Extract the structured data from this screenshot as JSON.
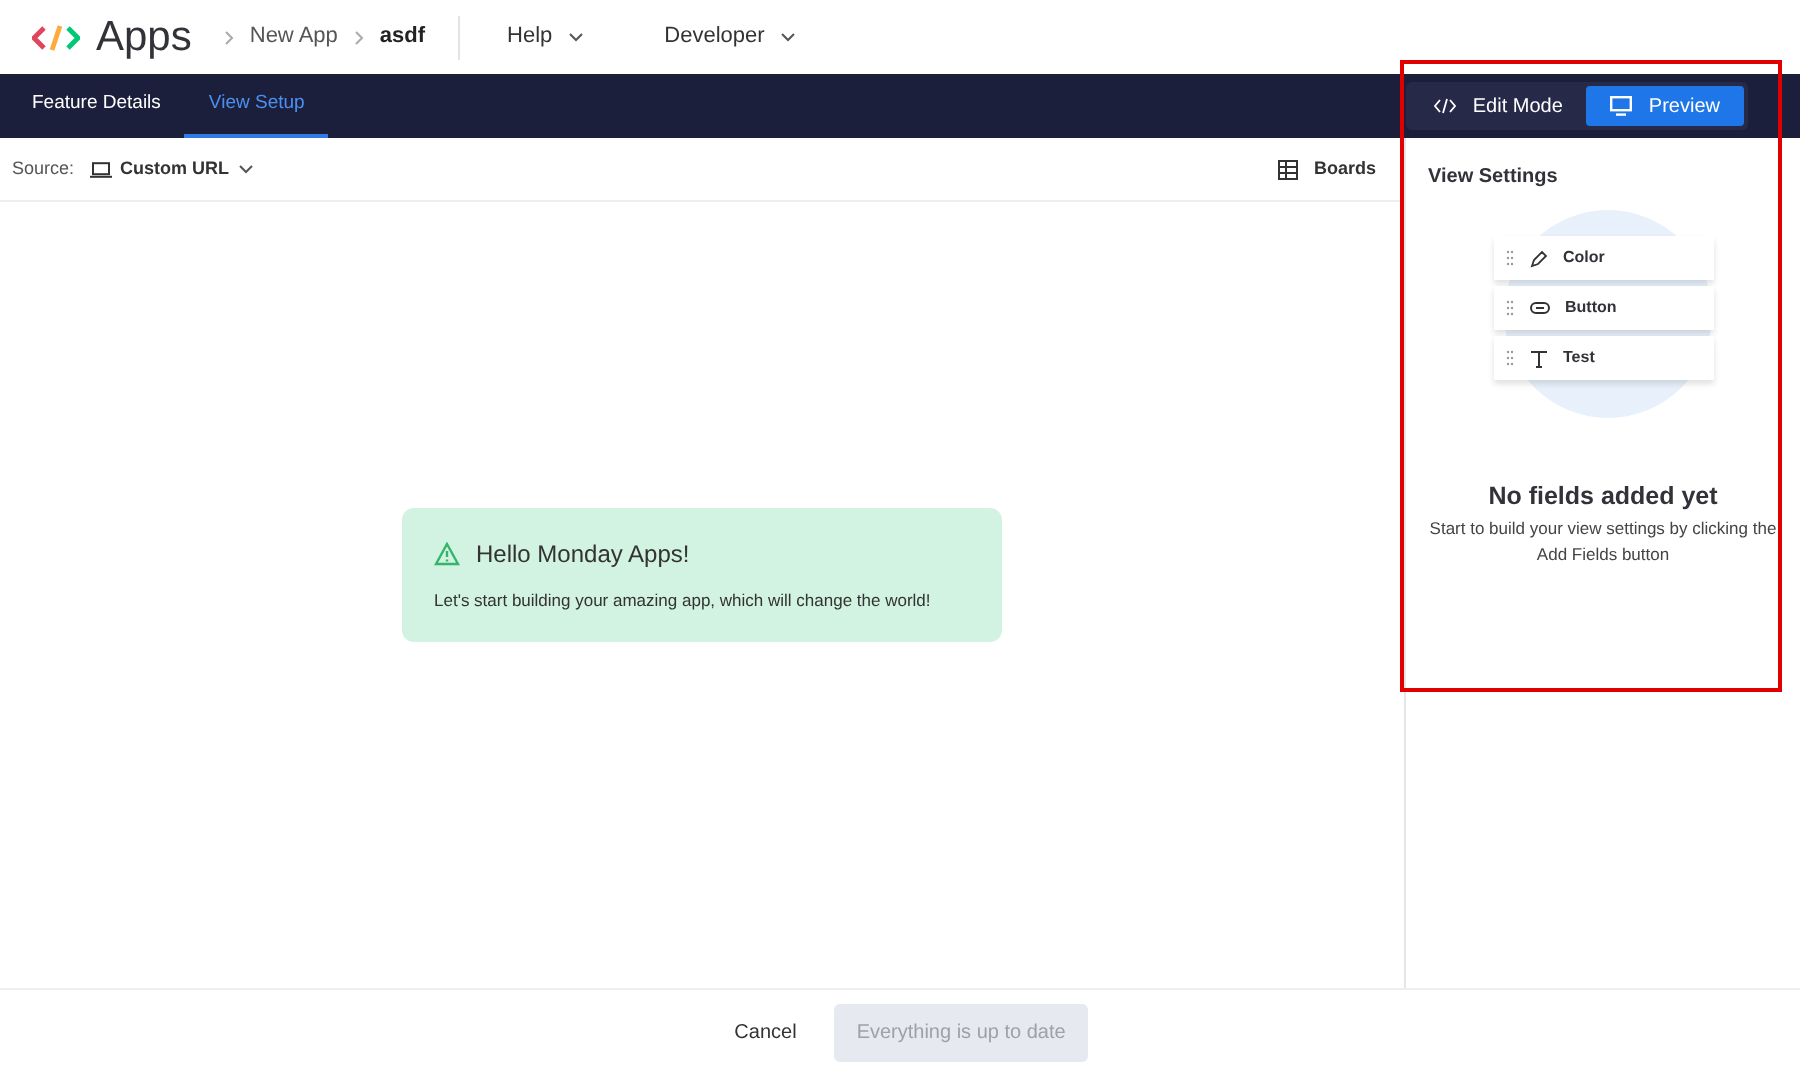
{
  "header": {
    "app_name": "Apps",
    "breadcrumbs": [
      {
        "label": "New App",
        "current": false
      },
      {
        "label": "asdf",
        "current": true
      }
    ],
    "menus": [
      "Help",
      "Developer"
    ]
  },
  "tabs": [
    {
      "label": "Feature Details",
      "selected": false
    },
    {
      "label": "View Setup",
      "selected": true
    }
  ],
  "mode_toggle": [
    {
      "kind": "code",
      "label": "Edit Mode",
      "selected": false
    },
    {
      "kind": "monitor",
      "label": "Preview",
      "selected": true
    }
  ],
  "toolbar": {
    "source_label": "Source:",
    "source_value": "Custom URL",
    "boards": "Boards"
  },
  "alert": {
    "title": "Hello Monday Apps!",
    "text": "Let's start building your amazing app, which will change the world!"
  },
  "view_settings": {
    "title": "View Settings",
    "sample_fields": [
      {
        "kind": "color",
        "label": "Color"
      },
      {
        "kind": "button",
        "label": "Button"
      },
      {
        "kind": "text",
        "label": "Test"
      }
    ],
    "empty_title": "No fields added yet",
    "empty_text": "Start to build your view settings by clicking the Add Fields button"
  },
  "footer": {
    "buttons": [
      {
        "label": "Cancel",
        "disabled": false
      },
      {
        "label": "Everything is up to date",
        "disabled": true
      }
    ]
  }
}
